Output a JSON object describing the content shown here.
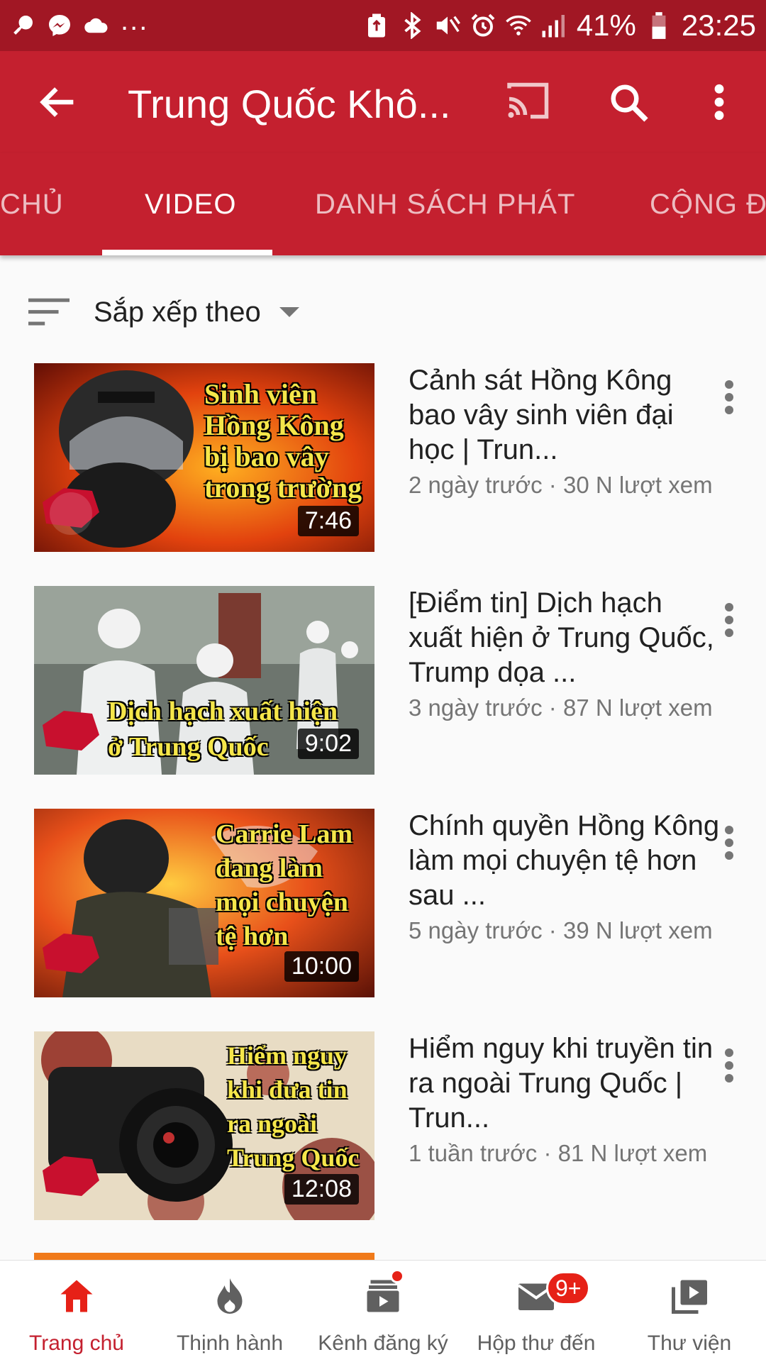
{
  "status_bar": {
    "left_icons": [
      "mic-icon",
      "messenger-icon",
      "cloud-icon"
    ],
    "overflow": "...",
    "right_icons": [
      "recycle-icon",
      "bluetooth-icon",
      "mute-icon",
      "alarm-icon",
      "wifi-icon",
      "signal-icon"
    ],
    "battery": "41%",
    "time": "23:25"
  },
  "app_bar": {
    "title": "Trung Quốc Khô...",
    "actions": [
      "cast-icon",
      "search-icon",
      "more-vert-icon"
    ]
  },
  "tabs": [
    {
      "label": "CHỦ",
      "active": false
    },
    {
      "label": "VIDEO",
      "active": true
    },
    {
      "label": "DANH SÁCH PHÁT",
      "active": false
    },
    {
      "label": "CỘNG ĐỒ",
      "active": false
    }
  ],
  "sort": {
    "label": "Sắp xếp theo"
  },
  "videos": [
    {
      "title": "Cảnh sát Hồng Kông bao vây sinh viên đại học | Trun...",
      "meta": "2 ngày trước · 30 N lượt xem",
      "duration": "7:46",
      "thumb_text": [
        "Sinh viên",
        "Hồng Kông",
        "bị bao vây",
        "trong trường"
      ]
    },
    {
      "title": "[Điểm tin] Dịch hạch xuất hiện ở Trung Quốc, Trump dọa ...",
      "meta": "3 ngày trước · 87 N lượt xem",
      "duration": "9:02",
      "thumb_text": [
        "Dịch hạch xuất hiện",
        "ở Trung Quốc"
      ]
    },
    {
      "title": "Chính quyền Hồng Kông làm mọi chuyện tệ hơn sau ...",
      "meta": "5 ngày trước · 39 N lượt xem",
      "duration": "10:00",
      "thumb_text": [
        "Carrie Lam",
        "đang làm",
        "mọi chuyện",
        "tệ hơn"
      ]
    },
    {
      "title": "Hiểm nguy khi truyền tin ra ngoài Trung Quốc | Trun...",
      "meta": "1 tuần trước · 81 N lượt xem",
      "duration": "12:08",
      "thumb_text": [
        "Hiểm nguy",
        "khi đưa tin",
        "ra ngoài",
        "Trung Quốc"
      ]
    }
  ],
  "bottom_nav": [
    {
      "label": "Trang chủ",
      "icon": "home-icon",
      "active": true
    },
    {
      "label": "Thịnh hành",
      "icon": "trending-icon",
      "active": false
    },
    {
      "label": "Kênh đăng ký",
      "icon": "subscriptions-icon",
      "active": false
    },
    {
      "label": "Hộp thư đến",
      "icon": "inbox-icon",
      "active": false,
      "badge": "9+"
    },
    {
      "label": "Thư viện",
      "icon": "library-icon",
      "active": false
    }
  ],
  "colors": {
    "status_bar": "#a11724",
    "app_bar": "#c4202f",
    "active_nav": "#c4202f",
    "badge": "#e62117",
    "thumb_text": "#f5e64a"
  }
}
